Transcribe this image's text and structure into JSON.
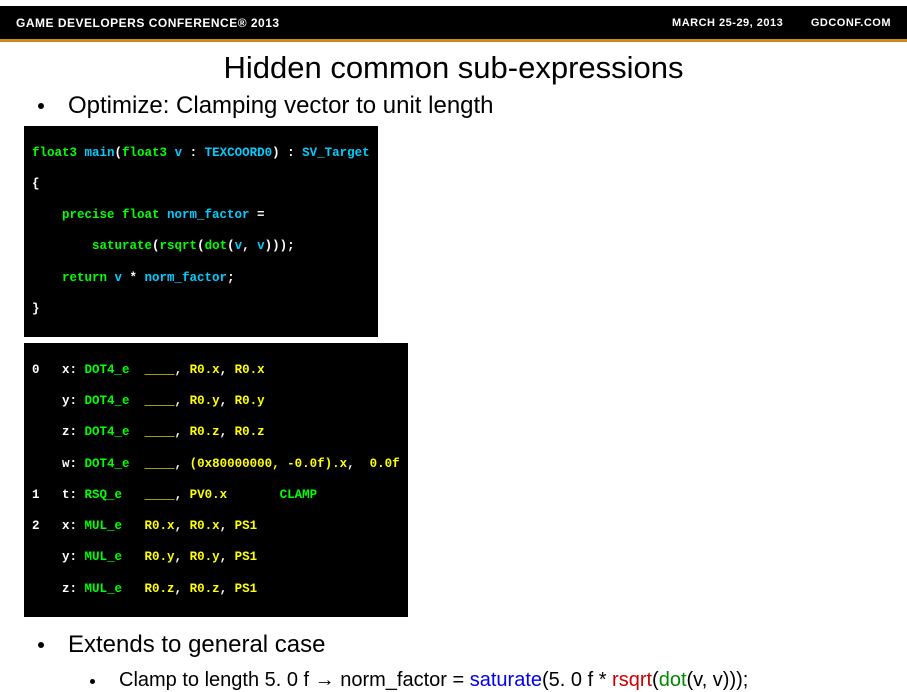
{
  "header": {
    "left": "GAME DEVELOPERS CONFERENCE® 2013",
    "date": "MARCH 25-29, 2013",
    "site": "GDCONF.COM"
  },
  "title": "Hidden common sub-expressions",
  "bullet1": "Optimize: Clamping vector to unit length",
  "code": {
    "l1a": "float3 ",
    "l1b": "main",
    "l1c": "(",
    "l1d": "float3 ",
    "l1e": "v ",
    "l1f": ": ",
    "l1g": "TEXCOORD0",
    "l1h": ") : ",
    "l1i": "SV_Target",
    "l2": "{",
    "l3a": "    precise float ",
    "l3b": "norm_factor ",
    "l3c": "=",
    "l4a": "        saturate",
    "l4b": "(",
    "l4c": "rsqrt",
    "l4d": "(",
    "l4e": "dot",
    "l4f": "(",
    "l4g": "v",
    "l4h": ", ",
    "l4i": "v",
    "l4j": ")));",
    "l5a": "    return ",
    "l5b": "v ",
    "l5c": "* ",
    "l5d": "norm_factor",
    "l5e": ";",
    "l6": "}"
  },
  "asm": {
    "r0": {
      "n": "0",
      "c": "   x: ",
      "op": "DOT4_e  ",
      "a": "____",
      "s1": ", ",
      "b": "R0.x",
      "s2": ", ",
      "d": "R0.x"
    },
    "r1": {
      "c": "    y: ",
      "op": "DOT4_e  ",
      "a": "____",
      "s1": ", ",
      "b": "R0.y",
      "s2": ", ",
      "d": "R0.y"
    },
    "r2": {
      "c": "    z: ",
      "op": "DOT4_e  ",
      "a": "____",
      "s1": ", ",
      "b": "R0.z",
      "s2": ", ",
      "d": "R0.z"
    },
    "r3": {
      "c": "    w: ",
      "op": "DOT4_e  ",
      "a": "____",
      "s1": ", ",
      "b": "(0x80000000, -0.0f).x",
      "s2": ",  ",
      "d": "0.0f"
    },
    "r4": {
      "n": "1",
      "c": "   t: ",
      "op": "RSQ_e   ",
      "a": "____",
      "s1": ", ",
      "b": "PV0.x",
      "clamp": "       CLAMP"
    },
    "r5": {
      "n": "2",
      "c": "   x: ",
      "op": "MUL_e   ",
      "a": "R0.x",
      "s1": ", ",
      "b": "R0.x",
      "s2": ", ",
      "d": "PS1"
    },
    "r6": {
      "c": "    y: ",
      "op": "MUL_e   ",
      "a": "R0.y",
      "s1": ", ",
      "b": "R0.y",
      "s2": ", ",
      "d": "PS1"
    },
    "r7": {
      "c": "    z: ",
      "op": "MUL_e   ",
      "a": "R0.z",
      "s1": ", ",
      "b": "R0.z",
      "s2": ", ",
      "d": "PS1"
    }
  },
  "bullet2": "Extends to general case",
  "sub": {
    "pre": "Clamp to length 5. 0 f → norm_factor = ",
    "sat": "saturate",
    "p1": "(5. 0 f * ",
    "rsqrt": "rsqrt",
    "p2": "(",
    "dot": "dot",
    "p3": "(v, v)));"
  }
}
